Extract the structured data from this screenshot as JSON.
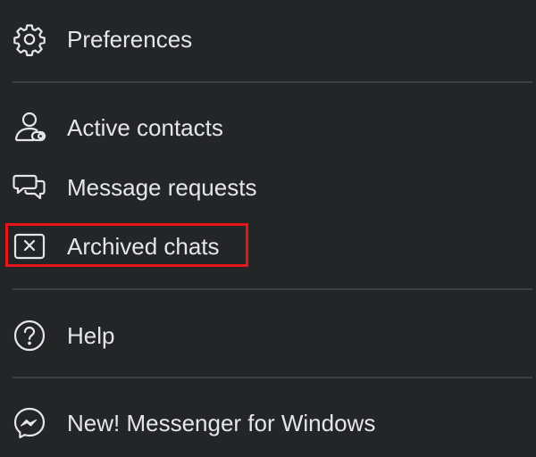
{
  "menu": {
    "items": [
      {
        "label": "Preferences",
        "icon": "gear-icon"
      },
      {
        "label": "Active contacts",
        "icon": "person-toggle-icon"
      },
      {
        "label": "Message requests",
        "icon": "chat-bubbles-icon"
      },
      {
        "label": "Archived chats",
        "icon": "archive-x-icon"
      },
      {
        "label": "Help",
        "icon": "question-circle-icon"
      },
      {
        "label": "New! Messenger for Windows",
        "icon": "messenger-icon"
      }
    ],
    "highlighted_item": "Archived chats",
    "highlight_color": "#e8141b",
    "background_color": "#242526",
    "text_color": "#e4e6eb",
    "divider_color": "#3e4042"
  }
}
